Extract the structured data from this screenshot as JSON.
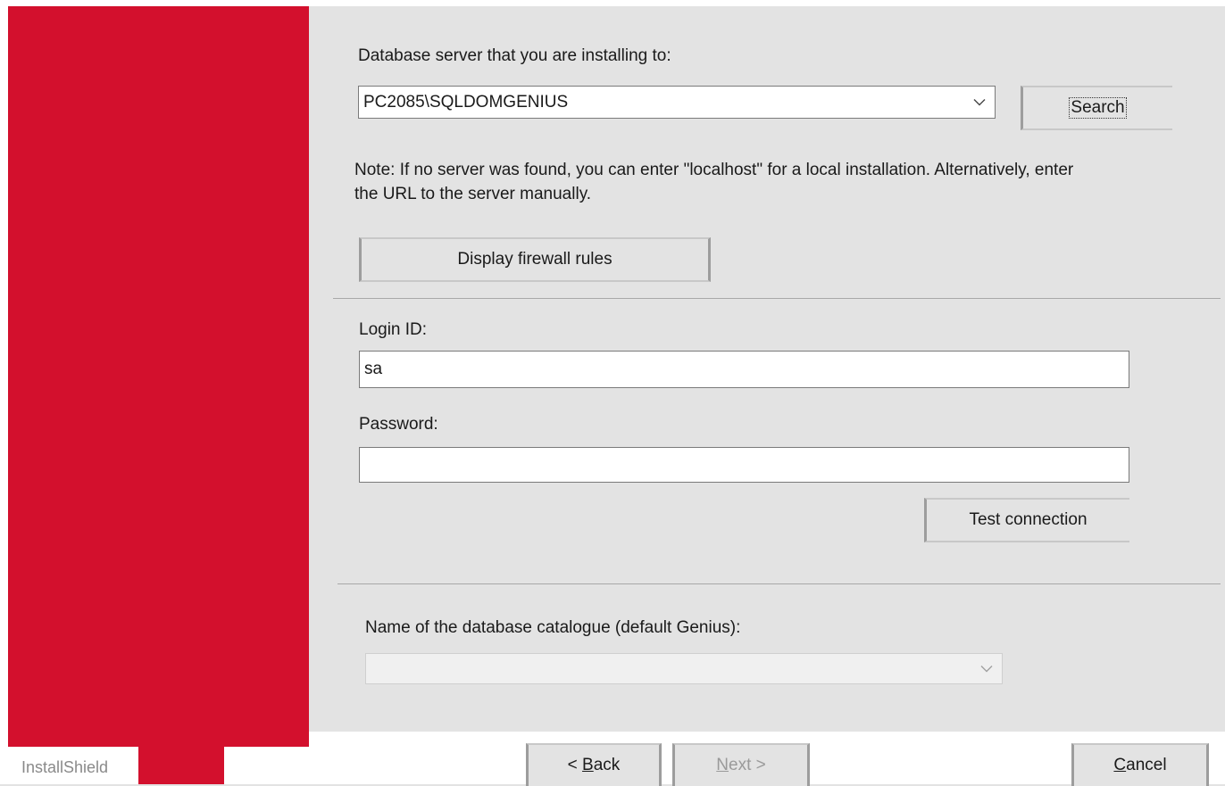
{
  "server": {
    "label": "Database server that you are installing to:",
    "value": "PC2085\\SQLDOMGENIUS",
    "search_label": "Search",
    "note_line1": "Note: If no server was found, you can enter \"localhost\" for a local installation. Alternatively, enter",
    "note_line2": "the URL to the server manually.",
    "firewall_label": "Display firewall rules"
  },
  "login": {
    "login_label": "Login ID:",
    "login_value": "sa",
    "password_label": "Password:",
    "password_value": "",
    "test_label": "Test connection"
  },
  "catalogue": {
    "label": "Name of the database catalogue (default Genius):",
    "value": ""
  },
  "footer": {
    "brand": "InstallShield",
    "back_prefix": "< ",
    "back_mnemonic": "B",
    "back_rest": "ack",
    "next_mnemonic": "N",
    "next_rest": "ext >",
    "cancel_mnemonic": "C",
    "cancel_rest": "ancel"
  },
  "colors": {
    "brand_red": "#d3102d",
    "panel_bg": "#e3e3e3"
  }
}
